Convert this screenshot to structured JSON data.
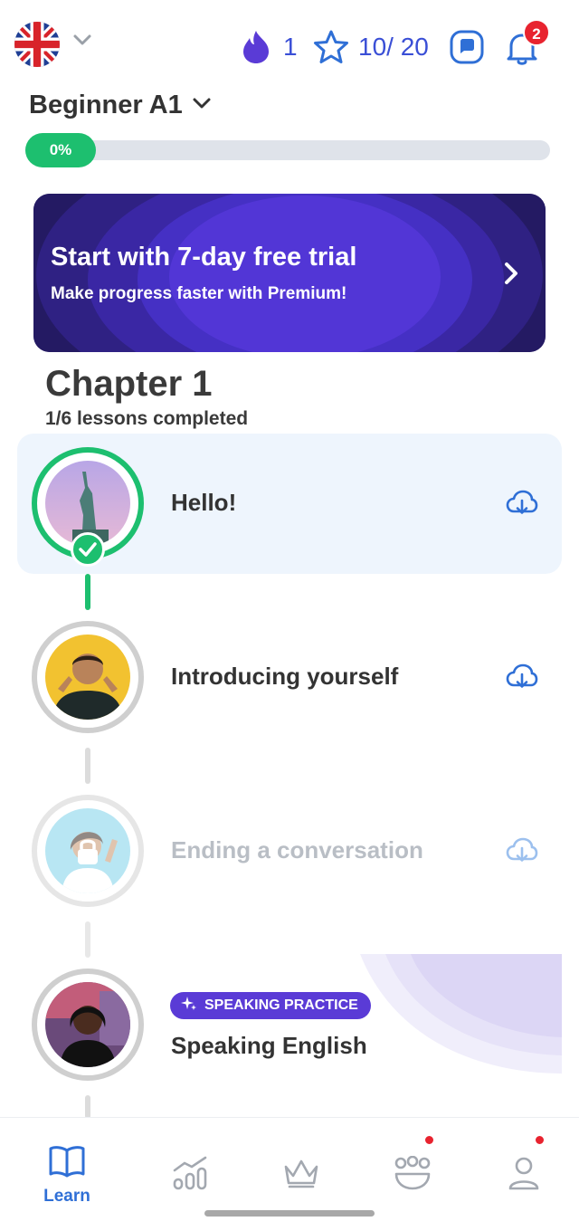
{
  "header": {
    "language_flag": "uk-flag-icon",
    "streak_count": "1",
    "xp_progress": "10/ 20",
    "notification_count": "2"
  },
  "level": {
    "title": "Beginner A1",
    "progress_label": "0%",
    "progress_fraction": 0
  },
  "promo_banner": {
    "title": "Start with 7-day free trial",
    "subtitle": "Make progress faster with Premium!"
  },
  "chapter": {
    "title": "Chapter 1",
    "subtitle": "1/6 lessons completed"
  },
  "lessons": [
    {
      "title": "Hello!",
      "status": "completed"
    },
    {
      "title": "Introducing yourself",
      "status": "available"
    },
    {
      "title": "Ending a conversation",
      "status": "locked"
    },
    {
      "title": "Speaking English",
      "status": "available",
      "tag": "SPEAKING PRACTICE"
    }
  ],
  "bottom_nav": {
    "items": [
      {
        "label": "Learn",
        "icon": "book-icon",
        "active": true
      },
      {
        "label": "",
        "icon": "progress-chart-icon",
        "active": false
      },
      {
        "label": "",
        "icon": "crown-icon",
        "active": false
      },
      {
        "label": "",
        "icon": "community-icon",
        "active": false
      },
      {
        "label": "",
        "icon": "profile-icon",
        "active": false
      }
    ]
  },
  "colors": {
    "accent_blue": "#2f6fd6",
    "success_green": "#1dbf6f",
    "premium_purple": "#5a3bd6",
    "alert_red": "#e8232f"
  }
}
